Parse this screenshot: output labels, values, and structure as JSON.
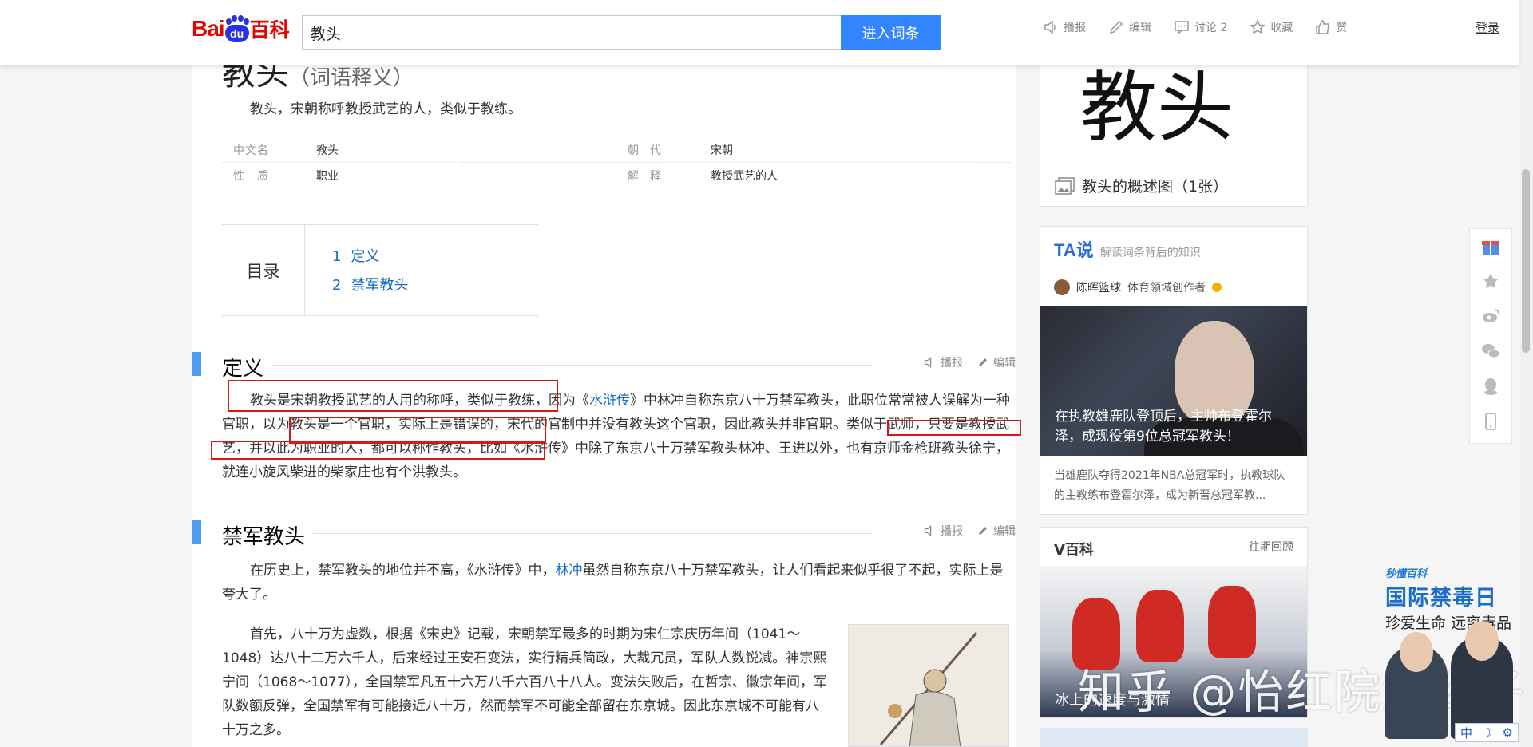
{
  "header": {
    "logo_bai": "Bai",
    "logo_du": "du",
    "logo_baike": "百科",
    "search_value": "教头",
    "search_button": "进入词条",
    "toolbar": [
      "播报",
      "编辑",
      "讨论 2",
      "收藏",
      "赞"
    ],
    "login": "登录"
  },
  "entry": {
    "title": "教头",
    "title_sub": "（词语释义）",
    "summary": "教头，宋朝称呼教授武艺的人，类似于教练。",
    "basic_info": [
      {
        "k1": "中文名",
        "v1": "教头",
        "k2": "朝　代",
        "v2": "宋朝"
      },
      {
        "k1": "性　质",
        "v1": "职业",
        "k2": "解　释",
        "v2": "教授武艺的人"
      }
    ],
    "toc_label": "目录",
    "toc": [
      {
        "num": "1",
        "label": "定义"
      },
      {
        "num": "2",
        "label": "禁军教头"
      }
    ]
  },
  "sections": [
    {
      "title": "定义",
      "tool1": "播报",
      "tool2": "编辑"
    },
    {
      "title": "禁军教头",
      "tool1": "播报",
      "tool2": "编辑"
    }
  ],
  "paragraphs": {
    "p1_a": "教头是宋朝教授武艺的人用的称呼，类似于教练，因为《",
    "p1_link": "水浒传",
    "p1_b": "》中林冲自称东京八十万禁军教头，此职位常常被人误解为一种官职，以为教头是一个官职，实际上是错误的，宋代的官制中并没有教头这个官职，因此教头并非官职。类似于武师，只要是教授武艺，并以此为职业的人，都可以称作教头，比如《水浒传》中除了东京八十万禁军教头林冲、王进以外，也有京师金枪班教头徐宁，就连小旋风柴进的柴家庄也有个洪教头。",
    "p2_a": "在历史上，禁军教头的地位并不高，《水浒传》中，",
    "p2_link": "林冲",
    "p2_b": "虽然自称东京八十万禁军教头，让人们看起来似乎很了不起，实际上是夸大了。",
    "p3": "首先，八十万为虚数，根据《宋史》记载，宋朝禁军最多的时期为宋仁宗庆历年间（1041～1048）达八十二万六千人，后来经过王安石变法，实行精兵简政，大裁冗员，军队人数锐减。神宗熙宁间（1068～1077），全国禁军凡五十六万八千六百八十八人。变法失败后，在哲宗、徽宗年间，军队数额反弹，全国禁军有可能接近八十万，然而禁军不可能全部留在东京城。因此东京城不可能有八十万之多。"
  },
  "sidebar": {
    "big_char": "教头",
    "image_caption": "教头的概述图（1张）",
    "ta_logo": "TA说",
    "ta_slogan": "解读词条背后的知识",
    "ta_author": "陈晖篮球",
    "ta_author_tag": "体育领域创作者",
    "ta_photo_title": "在执教雄鹿队登顶后，主帅布登霍尔泽，成现役第9位总冠军教头！",
    "ta_desc": "当雄鹿队夺得2021年NBA总冠军时，执教球队的主教练布登霍尔泽，成为新晋总冠军教...",
    "vbaike_title": "V百科",
    "vbaike_past": "往期回顾",
    "vbaike_photo_text": "冰上的速度与激情"
  },
  "watermark": "知乎 @怡红院大公子",
  "ad": {
    "brand": "秒懂百科",
    "title": "国际禁毒日",
    "subtitle": "珍爱生命 远离毒品"
  },
  "ime": {
    "lang": "中",
    "moon": "☽",
    "gear": "⚙"
  }
}
